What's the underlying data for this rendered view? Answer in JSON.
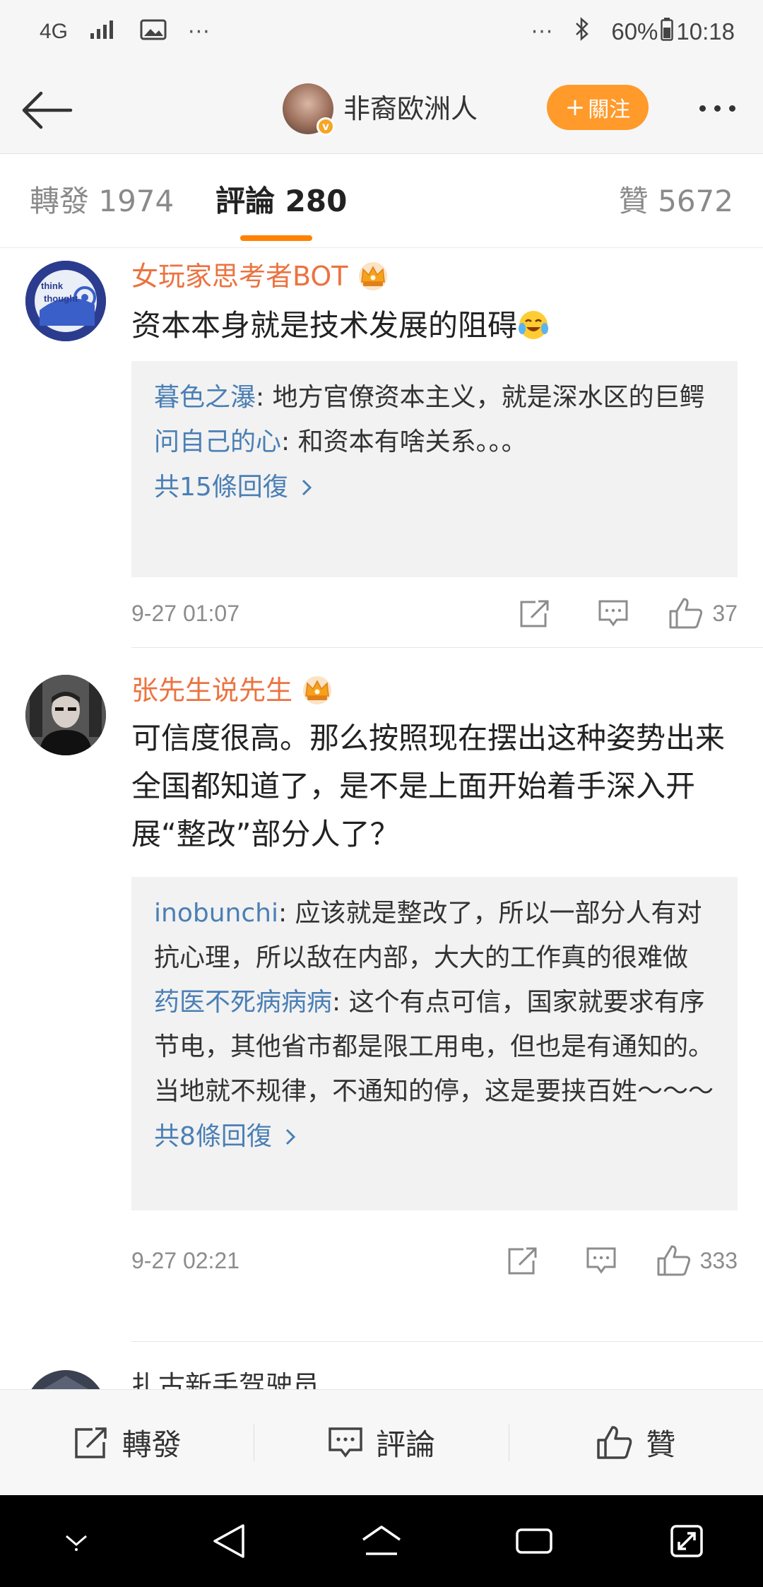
{
  "status_bar": {
    "network": "4G",
    "left_overflow": "···",
    "right_overflow": "···",
    "battery": "60%",
    "time": "10:18",
    "icons": [
      "signal-icon",
      "image-icon",
      "bluetooth-icon",
      "battery-icon"
    ]
  },
  "header": {
    "user_name": "非裔欧洲人",
    "follow_label": "關注",
    "follow_prefix": "+",
    "accent": "#ff9a2b"
  },
  "tabs": {
    "repost": "轉發 1974",
    "comments": "評論 280",
    "likes": "贊 5672",
    "active": "comments"
  },
  "comments": [
    {
      "name": "女玩家思考者BOT",
      "text": "资本本身就是技术发展的阻碍",
      "emoji": "crying-laughing-emoji",
      "avatar_text": [
        "think",
        "thought"
      ],
      "replies": [
        {
          "name": "暮色之瀑",
          "text": ": 地方官僚资本主义，就是深水区的巨鳄"
        },
        {
          "name": "问自己的心",
          "text": ": 和资本有啥关系。。。"
        }
      ],
      "more_replies": "共15條回復",
      "time": "9-27 01:07",
      "likes": "37"
    },
    {
      "name": "张先生说先生",
      "text": "可信度很高。那么按照现在摆出这种姿势出来全国都知道了，是不是上面开始着手深入开展“整改”部分人了？",
      "replies": [
        {
          "name": "inobunchi",
          "text": ": 应该就是整改了，所以一部分人有对抗心理，所以敌在内部，大大的工作真的很难做"
        },
        {
          "name": "药医不死病病病",
          "text": ": 这个有点可信，国家就要求有序节电，其他省市都是限工用电，但也是有通知的。当地就不规律，不通知的停，这是要挟百姓～～～"
        }
      ],
      "more_replies": "共8條回復",
      "time": "9-27 02:21",
      "likes": "333"
    },
    {
      "name": "扎古新手驾驶员"
    }
  ],
  "bottom_bar": {
    "repost": "轉發",
    "comment": "評論",
    "like": "贊"
  },
  "colors": {
    "name_orange": "#eb7340",
    "reply_blue": "#4a7fb5",
    "tab_underline": "#ff8200"
  }
}
